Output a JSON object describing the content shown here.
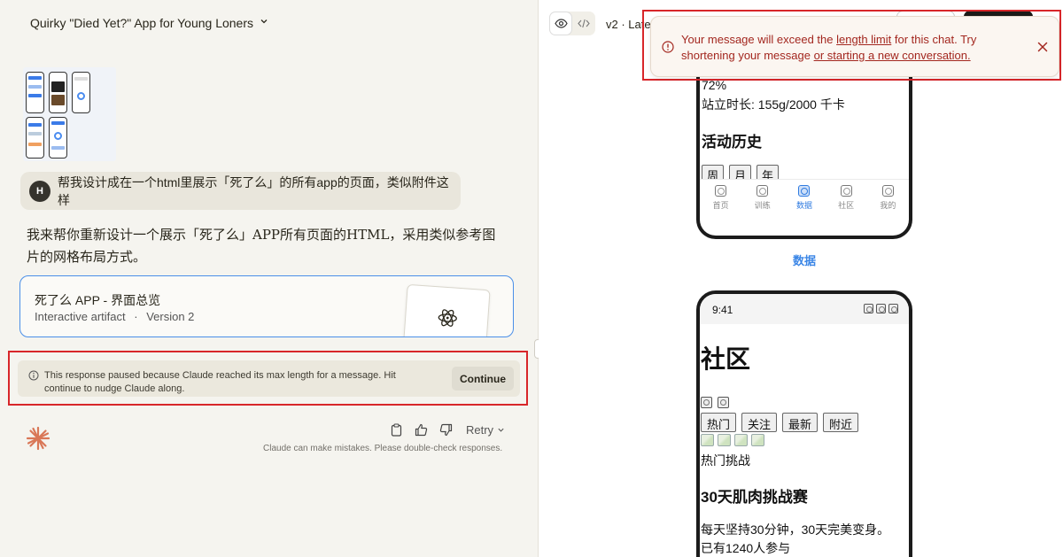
{
  "conversation": {
    "title": "Quirky \"Died Yet?\" App for Young Loners"
  },
  "user_message": {
    "avatar_initial": "H",
    "text": "帮我设计成在一个html里展示「死了么」的所有app的页面，类似附件这样"
  },
  "assistant": {
    "text": "我来帮你重新设计一个展示「死了么」APP所有页面的HTML，采用类似参考图片的网格布局方式。",
    "artifact": {
      "title": "死了么 APP - 界面总览",
      "type_label": "Interactive artifact",
      "separator": "·",
      "version_label": "Version 2"
    },
    "paused_notice": {
      "text": "This response paused because Claude reached its max length for a message. Hit continue to nudge Claude along.",
      "continue_label": "Continue"
    },
    "retry_label": "Retry",
    "disclaimer": "Claude can make mistakes. Please double-check responses."
  },
  "preview": {
    "version_label": "v2 · Late",
    "phone1": {
      "percent": "72%",
      "stand_line": "站立时长: 155g/2000 千卡",
      "history_title": "活动历史",
      "segments": [
        "周",
        "月",
        "年"
      ],
      "tabs": [
        {
          "label": "首页",
          "active": false
        },
        {
          "label": "训练",
          "active": false
        },
        {
          "label": "数据",
          "active": true
        },
        {
          "label": "社区",
          "active": false
        },
        {
          "label": "我的",
          "active": false
        }
      ]
    },
    "phone1_caption": "数据",
    "phone2": {
      "time": "9:41",
      "title": "社区",
      "filters": [
        "热门",
        "关注",
        "最新",
        "附近"
      ],
      "hot_label": "热门挑战",
      "challenge_title": "30天肌肉挑战赛",
      "challenge_desc_1": "每天坚持30分钟，30天完美变身。",
      "challenge_desc_2": "已有1240人参与"
    }
  },
  "toast": {
    "text_1": "Your message will exceed the ",
    "link_1": "length limit",
    "text_2": " for this chat. Try shortening your message ",
    "link_2": "or starting a new conversation.",
    "color": "#a3271f"
  },
  "colors": {
    "accent_blue": "#4a8fe8",
    "highlight_red": "#d8262a",
    "claude_orange": "#d97757"
  }
}
